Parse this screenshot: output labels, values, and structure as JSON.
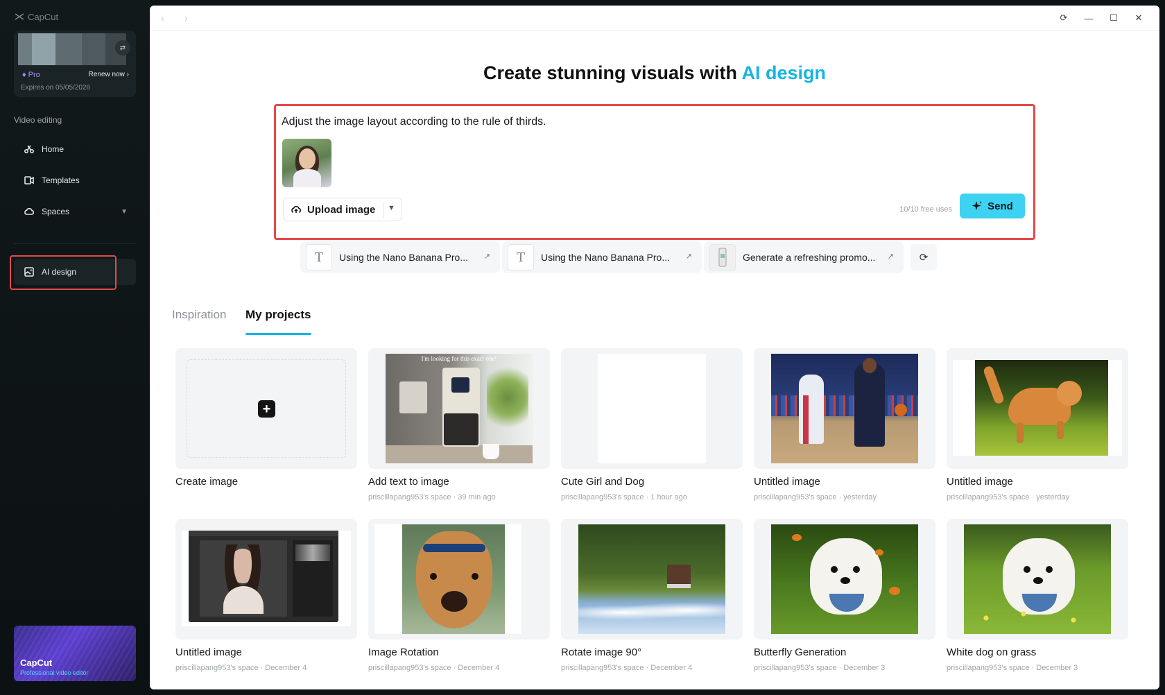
{
  "app": {
    "brand": "CapCut"
  },
  "account": {
    "plan": "Pro",
    "renew_label": "Renew now",
    "expires": "Expires on 05/05/2026"
  },
  "sidebar": {
    "section_label": "Video editing",
    "items": [
      {
        "label": "Home",
        "icon": "home-icon"
      },
      {
        "label": "Templates",
        "icon": "templates-icon"
      },
      {
        "label": "Spaces",
        "icon": "cloud-icon"
      },
      {
        "label": "AI design",
        "icon": "ai-design-icon"
      }
    ],
    "promo": {
      "title": "CapCut",
      "subtitle": "Professional video editor"
    }
  },
  "header": {
    "title_prefix": "Create stunning visuals with",
    "title_accent": "AI design"
  },
  "prompt": {
    "text": "Adjust the image layout according to the rule of thirds.",
    "upload_label": "Upload image",
    "free_uses": "10/10 free uses",
    "send_label": "Send"
  },
  "suggestions": [
    {
      "label": "Using the Nano Banana Pro..."
    },
    {
      "label": "Using the Nano Banana Pro..."
    },
    {
      "label": "Generate a refreshing promo..."
    }
  ],
  "tabs": [
    {
      "label": "Inspiration",
      "active": false
    },
    {
      "label": "My projects",
      "active": true
    }
  ],
  "projects": [
    {
      "title": "Create image",
      "meta": ""
    },
    {
      "title": "Add text to image",
      "meta": "priscillapang953's space · 39 min ago"
    },
    {
      "title": "Cute Girl and Dog",
      "meta": "priscillapang953's space · 1 hour ago"
    },
    {
      "title": "Untitled image",
      "meta": "priscillapang953's space · yesterday"
    },
    {
      "title": "Untitled image",
      "meta": "priscillapang953's space · yesterday"
    },
    {
      "title": "Untitled image",
      "meta": "priscillapang953's space · December 4"
    },
    {
      "title": "Image Rotation",
      "meta": "priscillapang953's space · December 4"
    },
    {
      "title": "Rotate image 90°",
      "meta": "priscillapang953's space · December 4"
    },
    {
      "title": "Butterfly Generation",
      "meta": "priscillapang953's space · December 3"
    },
    {
      "title": "White dog on grass",
      "meta": "priscillapang953's space · December 3"
    }
  ],
  "thumbnail_caption": "I'm looking for this exact one!",
  "colors": {
    "accent": "#16b4e6",
    "send": "#3ed2f2",
    "highlight": "#e34a4a",
    "pro": "#a98bff"
  }
}
